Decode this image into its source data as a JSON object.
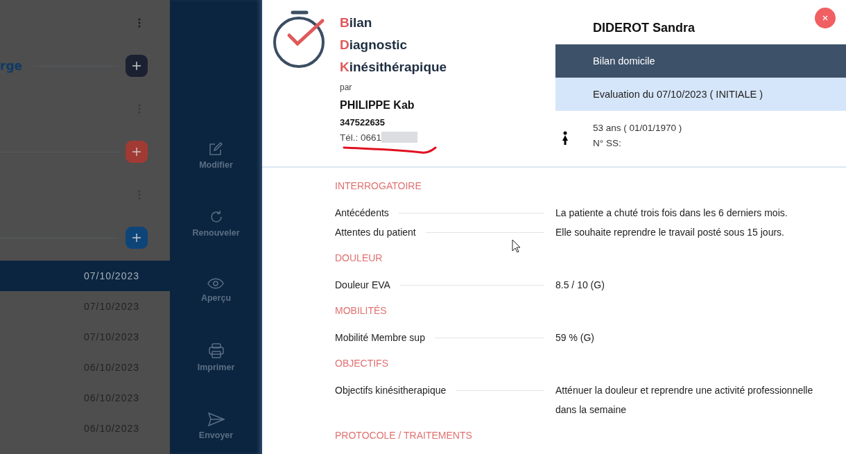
{
  "background": {
    "rows": [
      {
        "kind": "menu"
      },
      {
        "kind": "add",
        "label": "rge",
        "color": "#1b2130"
      },
      {
        "kind": "menu"
      },
      {
        "kind": "add",
        "color": "#a23a34"
      },
      {
        "kind": "menu"
      },
      {
        "kind": "add",
        "color": "#0e4579"
      }
    ],
    "dates": [
      {
        "text": "07/10/2023",
        "selected": true
      },
      {
        "text": "07/10/2023",
        "selected": false
      },
      {
        "text": "07/10/2023",
        "selected": false
      },
      {
        "text": "06/10/2023",
        "selected": false
      },
      {
        "text": "06/10/2023",
        "selected": false
      },
      {
        "text": "06/10/2023",
        "selected": false
      }
    ]
  },
  "actions": [
    {
      "kind": "edit",
      "label": "Modifier"
    },
    {
      "kind": "renew",
      "label": "Renouveler"
    },
    {
      "kind": "preview",
      "label": "Aperçu"
    },
    {
      "kind": "print",
      "label": "Imprimer"
    },
    {
      "kind": "send",
      "label": "Envoyer"
    }
  ],
  "report": {
    "title_words": [
      "Bilan",
      "Diagnostic",
      "Kinésithérapique"
    ],
    "by": "par",
    "practitioner": "PHILIPPE Kab",
    "number": "347522635",
    "phone": "Tél.: 0661",
    "patient": {
      "name": "DIDEROT Sandra",
      "visit_type": "Bilan domicile",
      "evaluation": "Evaluation du 07/10/2023 ( INITIALE )",
      "age": "53 ans ( 01/01/1970 )",
      "ss": "N° SS:"
    },
    "sections": [
      {
        "title": "INTERROGATOIRE",
        "rows": [
          {
            "label": "Antécédents",
            "value": "La patiente a chuté trois fois dans les 6 derniers mois."
          },
          {
            "label": "Attentes du patient",
            "value": "Elle souhaite reprendre le travail posté sous 15 jours."
          }
        ]
      },
      {
        "title": "DOULEUR",
        "rows": [
          {
            "label": "Douleur EVA",
            "value": "8.5 / 10 (G)"
          }
        ]
      },
      {
        "title": "MOBILITÉS",
        "rows": [
          {
            "label": "Mobilité Membre sup",
            "value": "59 % (G)"
          }
        ]
      },
      {
        "title": "OBJECTIFS",
        "rows": [
          {
            "label": "Objectifs kinésitherapique",
            "value": "Atténuer la douleur et reprendre une activité professionnelle dans la semaine"
          }
        ]
      },
      {
        "title": "PROTOCOLE / TRAITEMENTS"
      }
    ]
  }
}
